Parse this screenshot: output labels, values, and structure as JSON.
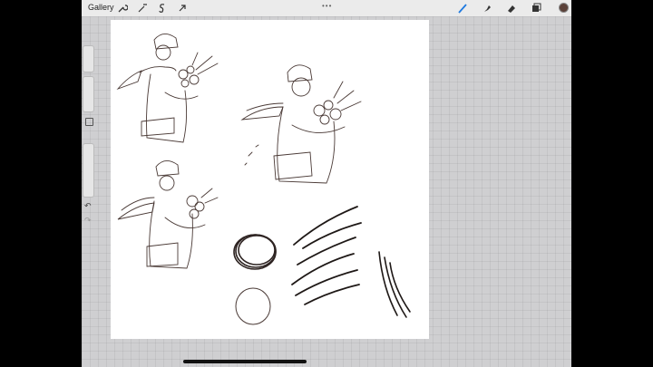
{
  "topbar": {
    "gallery_label": "Gallery",
    "more_label": "•••"
  },
  "colors": {
    "active_tool": "#1f7ae0",
    "current_color": "#5a4038"
  },
  "sidebar": {
    "undo_label": "↶",
    "redo_label": "↷"
  }
}
